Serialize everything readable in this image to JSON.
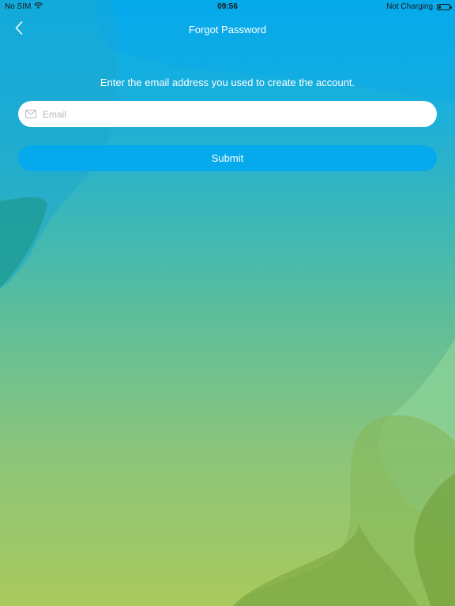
{
  "status_bar": {
    "carrier": "No SIM",
    "time": "09:56",
    "charging": "Not Charging",
    "battery_level": 0.25
  },
  "nav": {
    "title": "Forgot Password",
    "back_icon": "chevron-left-icon"
  },
  "form": {
    "instruction": "Enter the email address you used to create the account.",
    "email_placeholder": "Email",
    "email_value": "",
    "email_icon": "mail-icon",
    "submit_label": "Submit"
  },
  "colors": {
    "background_top": "#04acec",
    "background_bottom": "#a9c95c",
    "submit_button": "#05a9ec",
    "input_background": "#ffffff",
    "text": "#ffffff"
  }
}
